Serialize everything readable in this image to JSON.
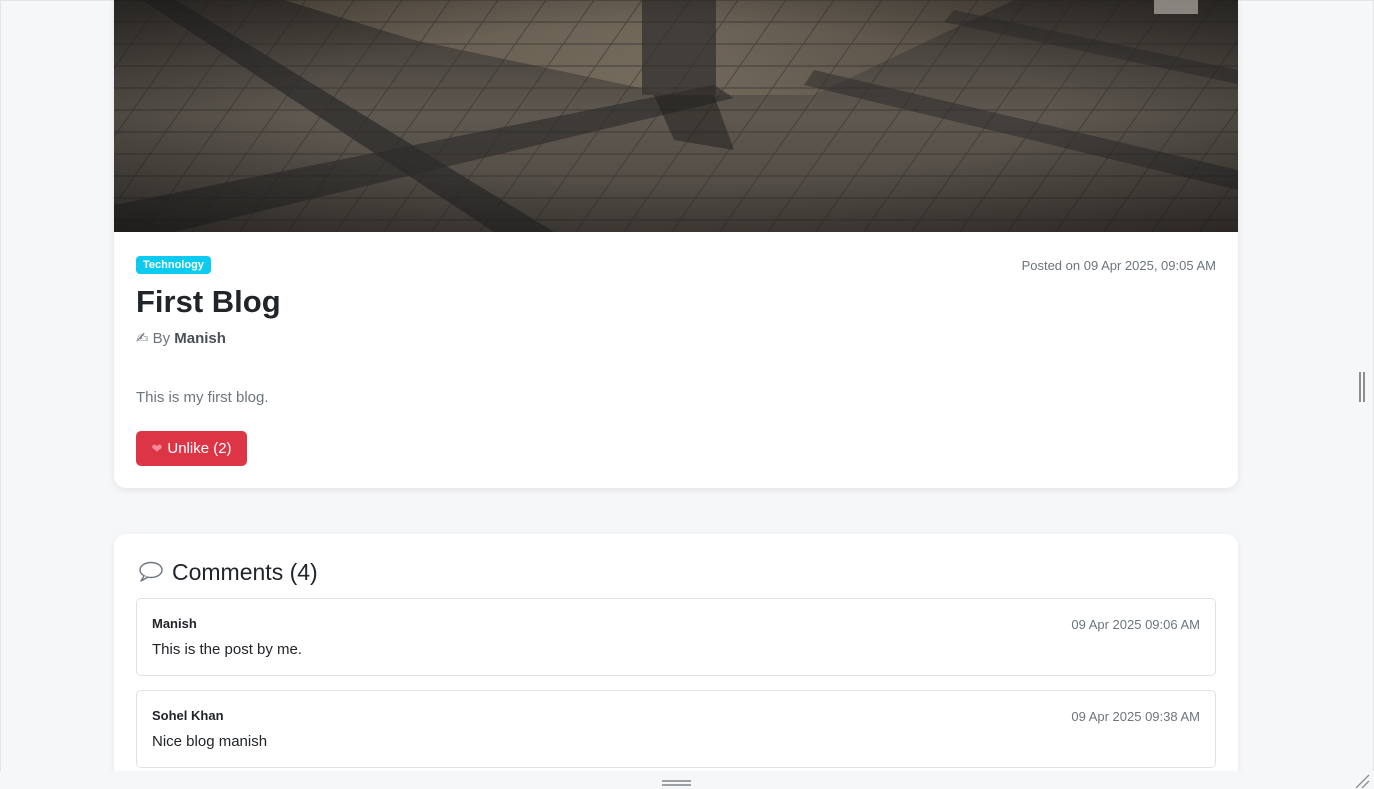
{
  "post": {
    "category": "Technology",
    "posted": "Posted on 09 Apr 2025, 09:05 AM",
    "title": "First Blog",
    "author_prefix": "By",
    "author": "Manish",
    "body": "This is my first blog.",
    "like_button": "Unlike (2)",
    "hero_icon": "stone-floor-photo",
    "author_icon": "writing-hand-icon",
    "like_icon": "heart-icon"
  },
  "comments": {
    "heading": "Comments (4)",
    "icon": "speech-bubble-icon",
    "items": [
      {
        "author": "Manish",
        "time": "09 Apr 2025 09:06 AM",
        "text": "This is the post by me."
      },
      {
        "author": "Sohel Khan",
        "time": "09 Apr 2025 09:38 AM",
        "text": "Nice blog manish"
      }
    ]
  },
  "colors": {
    "badge": "#0dcaf0",
    "unlike": "#dc3545",
    "page_bg": "#f6f7f9"
  }
}
